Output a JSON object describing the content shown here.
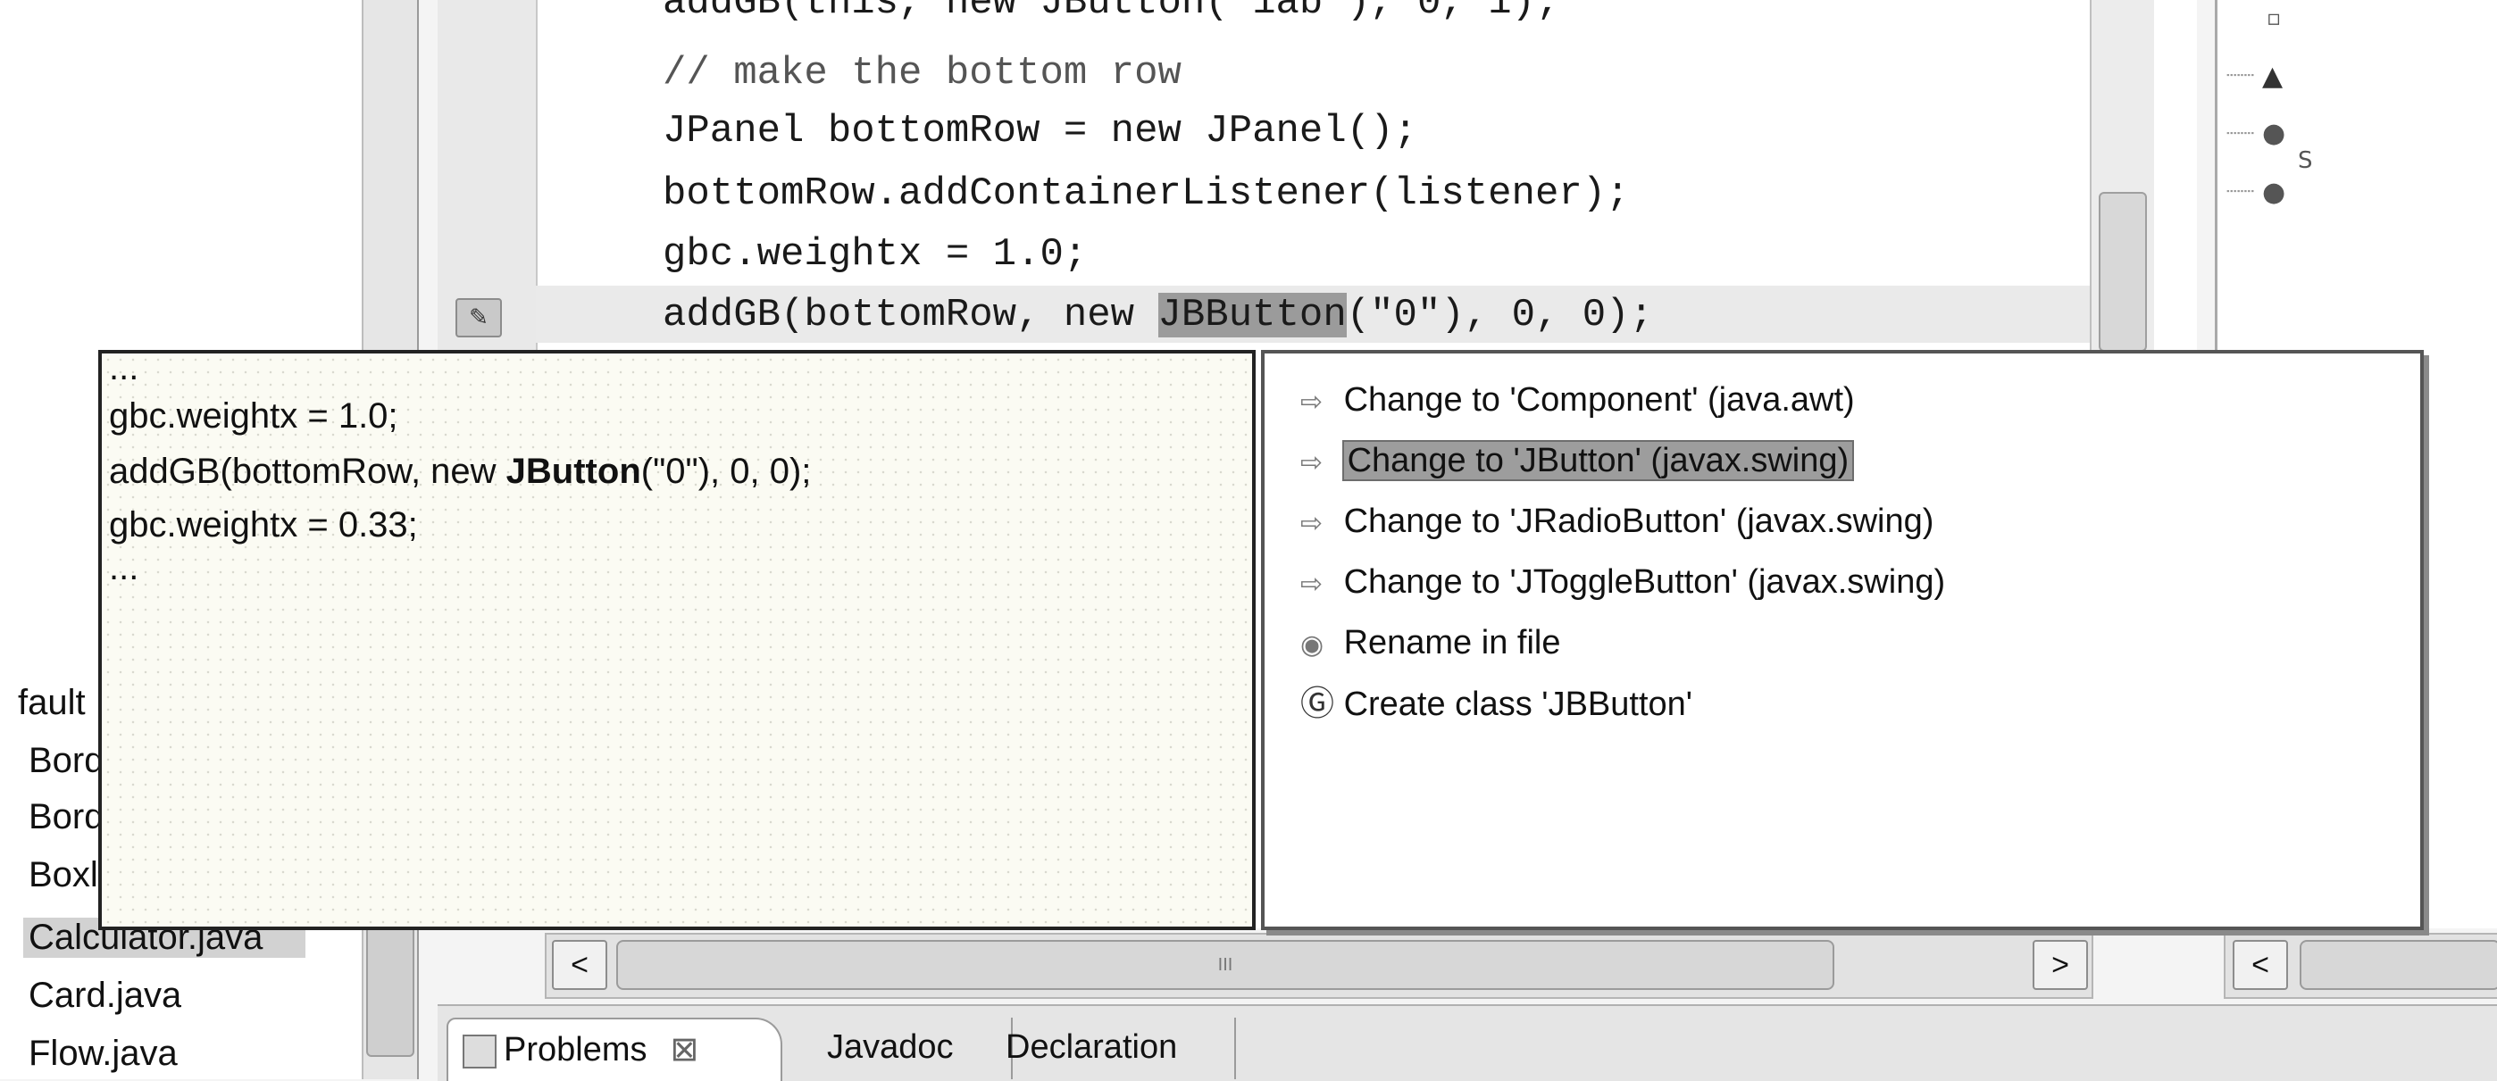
{
  "package_explorer": {
    "items": [
      {
        "label": "fault",
        "selected": false
      },
      {
        "label": "Bord",
        "selected": false
      },
      {
        "label": "Bord",
        "selected": false
      },
      {
        "label": "Boxl",
        "selected": false
      },
      {
        "label": "Calculator.java",
        "selected": true
      },
      {
        "label": "Card.java",
        "selected": false
      },
      {
        "label": "Flow.java",
        "selected": false
      }
    ]
  },
  "editor": {
    "lines": [
      "addGB(this, new JButton(\"1ab\"), 0, 1);",
      "// make the bottom row",
      "JPanel bottomRow = new JPanel();",
      "bottomRow.addContainerListener(listener);",
      "gbc.weightx = 1.0;"
    ],
    "error_line": {
      "before": "addGB(bottomRow, new ",
      "highlight": "JBButton",
      "after": "(\"0\"), 0, 0);"
    },
    "hscroll_thumb_label": "III"
  },
  "preview": {
    "lines": [
      "...",
      "gbc.weightx = 1.0;",
      {
        "before": "addGB(bottomRow, new ",
        "bold": "JButton",
        "after": "(\"0\"), 0, 0);"
      },
      "gbc.weightx = 0.33;",
      "..."
    ]
  },
  "proposals": {
    "items": [
      {
        "label": "Change to 'Component' (java.awt)",
        "icon": "rename-arrow-icon"
      },
      {
        "label": "Change to 'JButton' (javax.swing)",
        "icon": "rename-arrow-icon",
        "selected": true
      },
      {
        "label": "Change to 'JRadioButton' (javax.swing)",
        "icon": "rename-arrow-icon"
      },
      {
        "label": "Change to 'JToggleButton' (javax.swing)",
        "icon": "rename-arrow-icon"
      },
      {
        "label": "Rename in file",
        "icon": "dot-icon"
      },
      {
        "label": "Create class 'JBButton'",
        "icon": "class-icon"
      }
    ]
  },
  "tabs": {
    "problems": "Problems",
    "problems_close": "⊠",
    "javadoc": "Javadoc",
    "declaration": "Declaration"
  },
  "outline": {
    "label": "S"
  }
}
